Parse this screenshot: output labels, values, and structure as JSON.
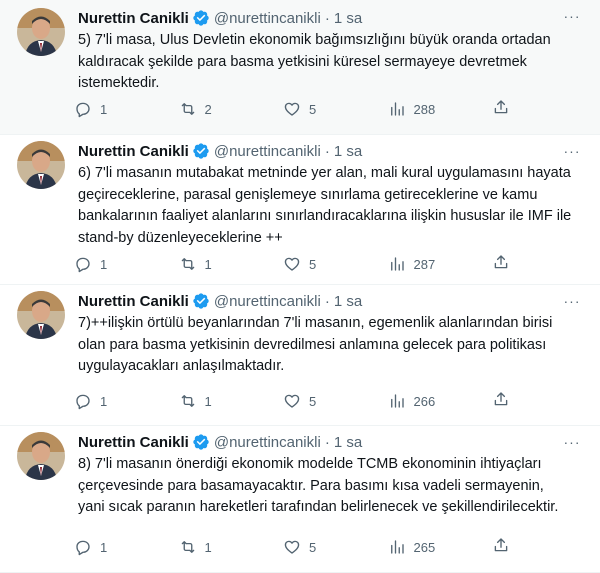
{
  "colors": {
    "verified": "#1d9bf0",
    "secondary_text": "#536471",
    "primary_text": "#0f1419",
    "highlight_bg": "#f7f9f9"
  },
  "tweets": [
    {
      "name": "Nurettin Canikli",
      "handle": "@nurettincanikli",
      "separator": "·",
      "time": "1 sa",
      "text": "5) 7'li masa, Ulus Devletin ekonomik bağımsızlığını büyük oranda ortadan kaldıracak şekilde para basma yetkisini küresel sermayeye devretmek istemektedir.",
      "replies": "1",
      "retweets": "2",
      "likes": "5",
      "views": "288"
    },
    {
      "name": "Nurettin Canikli",
      "handle": "@nurettincanikli",
      "separator": "·",
      "time": "1 sa",
      "text": "6) 7'li masanın mutabakat metninde yer alan, mali kural uygulamasını hayata geçireceklerine, parasal genişlemeye sınırlama getireceklerine ve kamu bankalarının faaliyet alanlarını sınırlandıracaklarına ilişkin hususlar ile IMF ile stand-by düzenleyeceklerine ++",
      "replies": "1",
      "retweets": "1",
      "likes": "5",
      "views": "287"
    },
    {
      "name": "Nurettin Canikli",
      "handle": "@nurettincanikli",
      "separator": "·",
      "time": "1 sa",
      "text": "7)++ilişkin örtülü beyanlarından 7'li masanın, egemenlik alanlarından birisi olan para basma yetkisinin devredilmesi anlamına gelecek para politikası uygulayacakları anlaşılmaktadır.",
      "replies": "1",
      "retweets": "1",
      "likes": "5",
      "views": "266"
    },
    {
      "name": "Nurettin Canikli",
      "handle": "@nurettincanikli",
      "separator": "·",
      "time": "1 sa",
      "text": "8) 7'li masanın önerdiği ekonomik modelde TCMB ekonominin ihtiyaçları çerçevesinde para basamayacaktır. Para basımı kısa vadeli sermayenin, yani sıcak paranın hareketleri tarafından belirlenecek ve şekillendirilecektir.",
      "replies": "1",
      "retweets": "1",
      "likes": "5",
      "views": "265"
    }
  ],
  "icons": {
    "reply": "speech-bubble-icon",
    "retweet": "retweet-arrows-icon",
    "like": "heart-icon",
    "views": "bar-chart-icon",
    "share": "share-arrow-icon",
    "verified": "verified-badge-icon",
    "more": "more-dots-icon"
  }
}
